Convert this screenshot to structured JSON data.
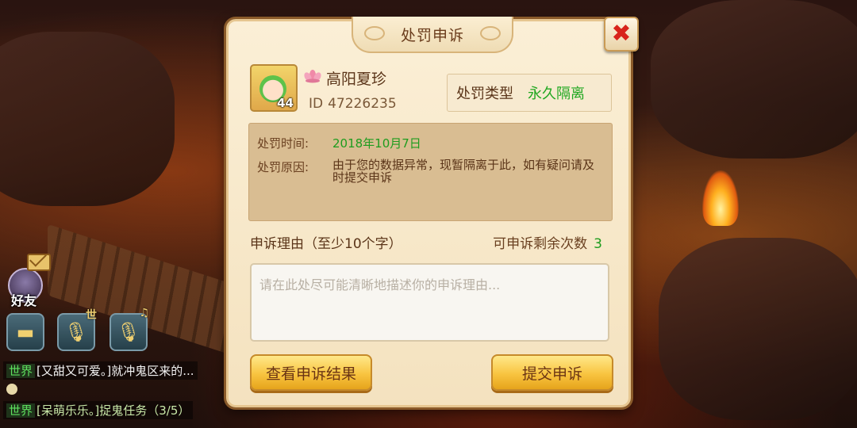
{
  "dialog": {
    "title": "处罚申诉",
    "close_label": "✖",
    "player": {
      "name": "高阳夏珍",
      "id_prefix": "ID",
      "id": "47226235",
      "level": "44"
    },
    "penalty_type": {
      "label": "处罚类型",
      "value": "永久隔离"
    },
    "info": {
      "time_label": "处罚时间:",
      "time_value": "2018年10月7日",
      "reason_label": "处罚原因:",
      "reason_value": "由于您的数据异常，现暂隔离于此，如有疑问请及时提交申诉"
    },
    "appeal_reason_label": "申诉理由（至少10个字）",
    "remaining_label": "可申诉剩余次数",
    "remaining_count": "3",
    "input_placeholder": "请在此处尽可能清晰地描述你的申诉理由...",
    "buttons": {
      "view_results": "查看申诉结果",
      "submit": "提交申诉"
    }
  },
  "hud": {
    "friends_label": "好友",
    "voice_world_tag": "世",
    "voice_team_tag": "♫"
  },
  "chat": [
    {
      "channel": "世界",
      "text": "[又甜又可爱。]就冲鬼区来的..."
    },
    {
      "channel": "世界",
      "text": "[呆萌乐乐。]捉鬼任务（3/5）"
    }
  ],
  "colors": {
    "accent_green": "#1e9c1e",
    "close_red": "#d8231c",
    "button_gold": "#f8c440"
  }
}
